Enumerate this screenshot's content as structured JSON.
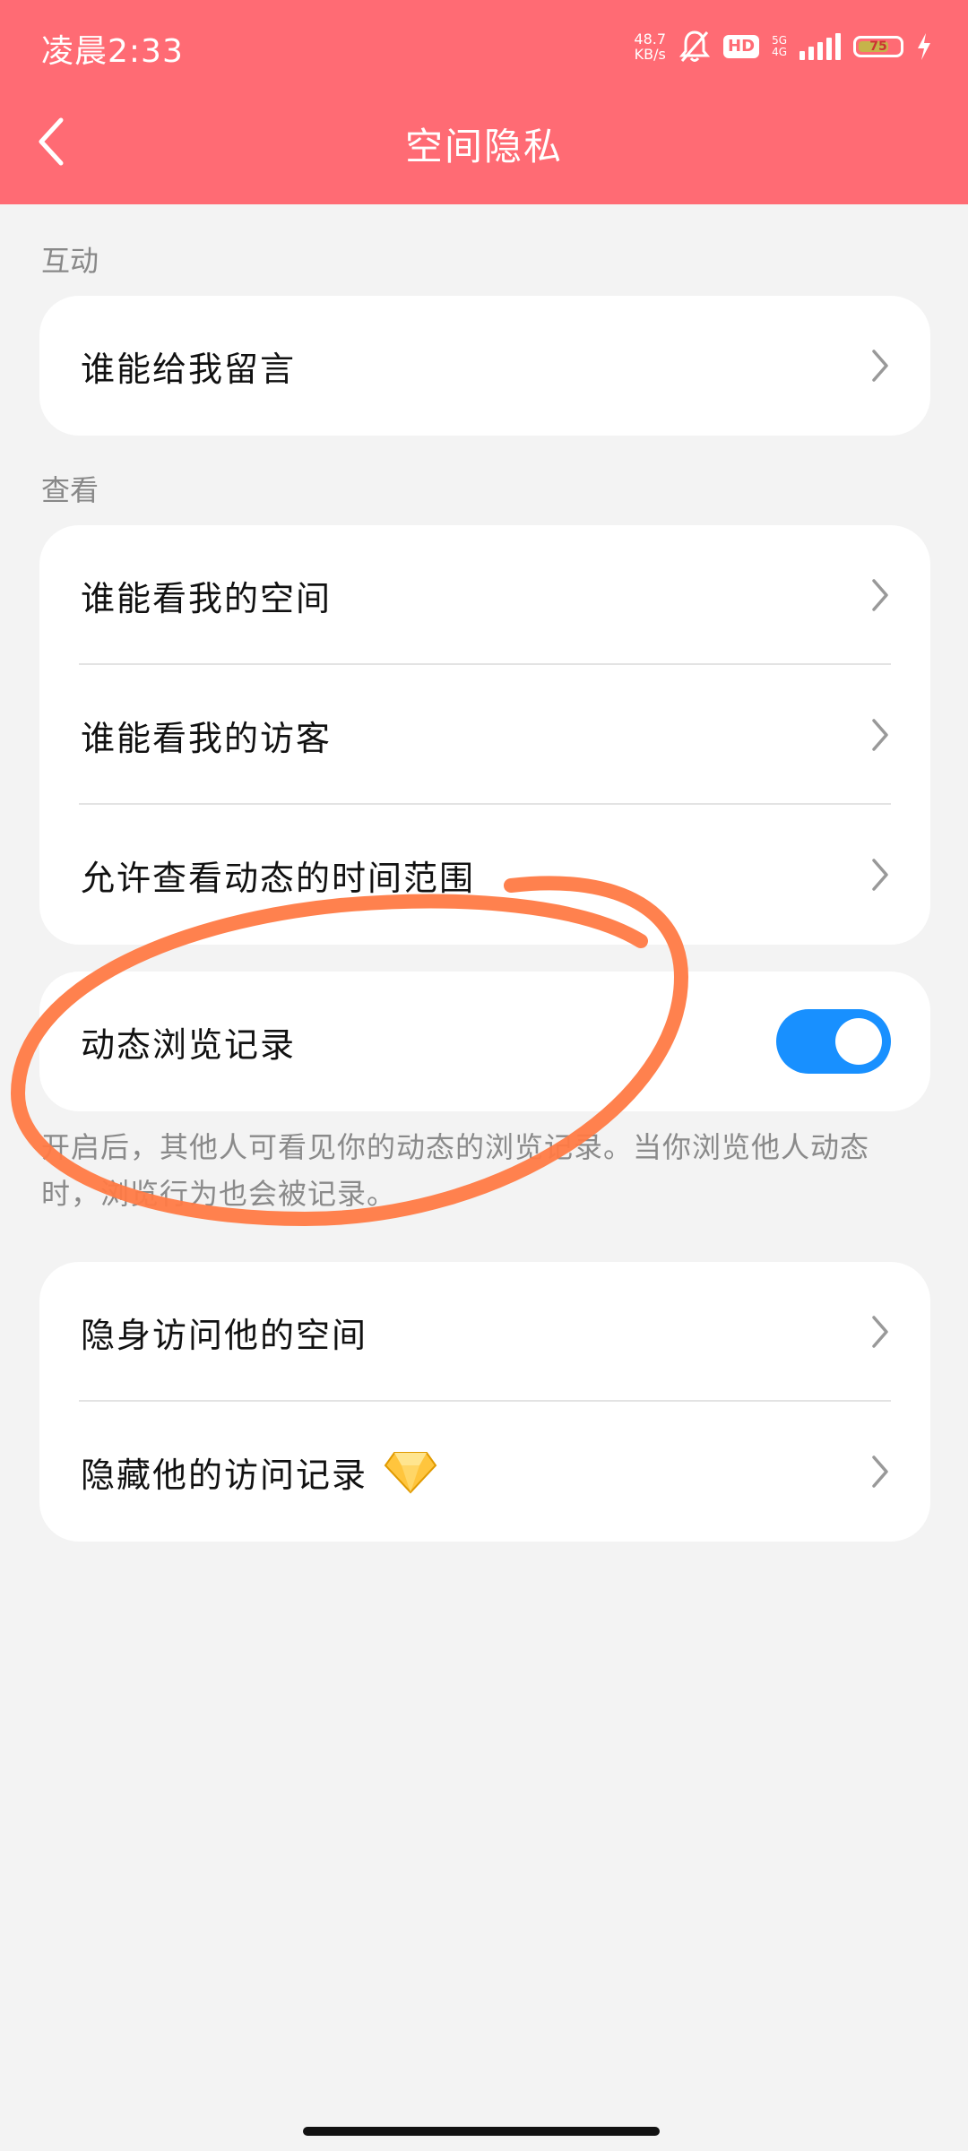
{
  "status_bar": {
    "time": "凌晨2:33",
    "net_speed_value": "48.7",
    "net_speed_unit": "KB/s",
    "hd_label": "HD",
    "network_top": "5G",
    "network_bottom": "4G",
    "battery_level": "75"
  },
  "header": {
    "title": "空间隐私"
  },
  "sections": {
    "interaction_label": "互动",
    "view_label": "查看"
  },
  "rows": {
    "message": "谁能给我留言",
    "view_space": "谁能看我的空间",
    "view_visitors": "谁能看我的访客",
    "time_range": "允许查看动态的时间范围",
    "browse_record": "动态浏览记录",
    "invisible_visit": "隐身访问他的空间",
    "hide_visit_record": "隐藏他的访问记录"
  },
  "toggle": {
    "browse_record_on": true
  },
  "notes": {
    "browse_record_desc": "开启后，其他人可看见你的动态的浏览记录。当你浏览他人动态时，浏览行为也会被记录。"
  },
  "colors": {
    "header_bg": "#ff6b74",
    "toggle_on": "#1890ff",
    "annotation": "#ff7a45"
  }
}
